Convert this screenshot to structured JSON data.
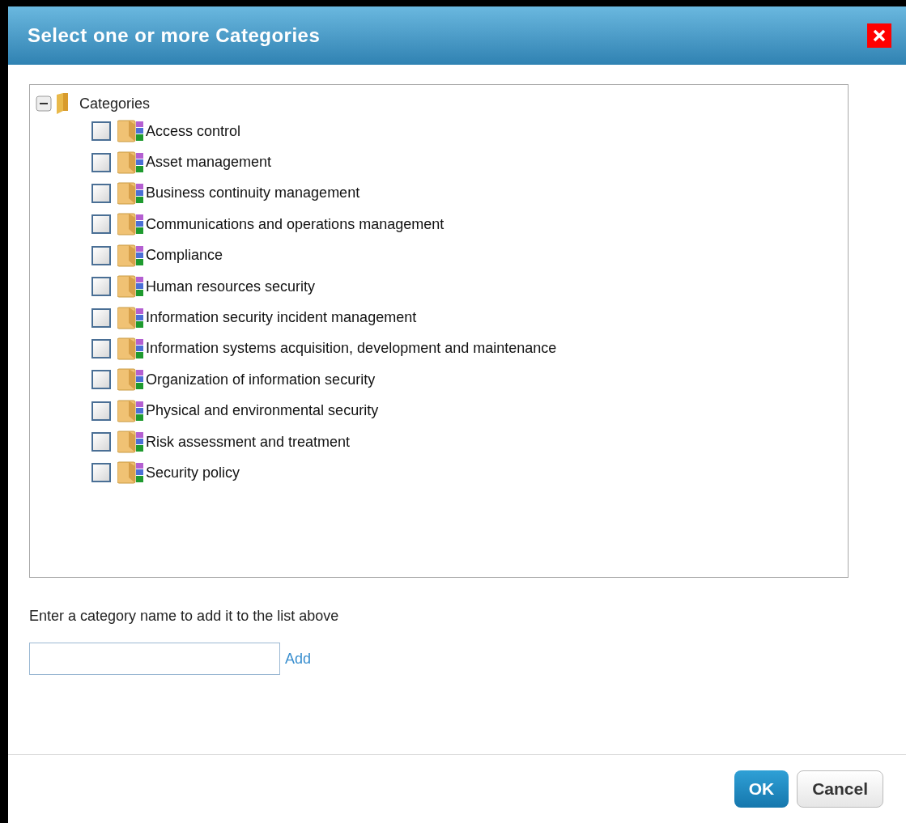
{
  "dialog": {
    "title": "Select one or more Categories"
  },
  "tree": {
    "label": "Categories",
    "expanded": true,
    "children": [
      {
        "label": "Access control",
        "checked": false
      },
      {
        "label": "Asset management",
        "checked": false
      },
      {
        "label": "Business continuity management",
        "checked": false
      },
      {
        "label": "Communications and operations management",
        "checked": false
      },
      {
        "label": "Compliance",
        "checked": false
      },
      {
        "label": "Human resources security",
        "checked": false
      },
      {
        "label": "Information security incident management",
        "checked": false
      },
      {
        "label": "Information systems acquisition, development and maintenance",
        "checked": false
      },
      {
        "label": "Organization of information security",
        "checked": false
      },
      {
        "label": "Physical and environmental security",
        "checked": false
      },
      {
        "label": "Risk assessment and treatment",
        "checked": false
      },
      {
        "label": "Security policy",
        "checked": false
      }
    ]
  },
  "add_form": {
    "prompt": "Enter a category name to add it to the list above",
    "link": "Add"
  },
  "buttons": [
    {
      "label": "OK",
      "kind": "primary"
    },
    {
      "label": "Cancel",
      "kind": "secondary"
    }
  ]
}
